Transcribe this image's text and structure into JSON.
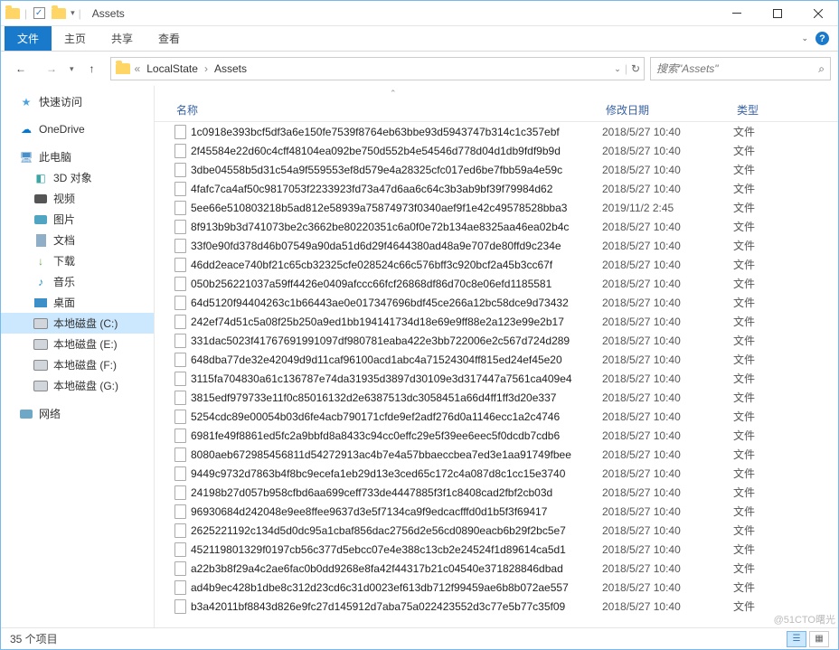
{
  "window": {
    "title": "Assets"
  },
  "tabs": {
    "file": "文件",
    "home": "主页",
    "share": "共享",
    "view": "查看"
  },
  "breadcrumbs": {
    "sep": "«",
    "items": [
      "LocalState",
      "Assets"
    ]
  },
  "search": {
    "placeholder": "搜索\"Assets\""
  },
  "nav": {
    "quick": "快速访问",
    "onedrive": "OneDrive",
    "pc": "此电脑",
    "pc_children": [
      "3D 对象",
      "视频",
      "图片",
      "文档",
      "下载",
      "音乐",
      "桌面",
      "本地磁盘 (C:)",
      "本地磁盘 (E:)",
      "本地磁盘 (F:)",
      "本地磁盘 (G:)"
    ],
    "network": "网络"
  },
  "columns": {
    "name": "名称",
    "date": "修改日期",
    "type": "类型"
  },
  "files": [
    {
      "n": "1c0918e393bcf5df3a6e150fe7539f8764eb63bbe93d5943747b314c1c357ebf",
      "d": "2018/5/27 10:40",
      "t": "文件"
    },
    {
      "n": "2f45584e22d60c4cff48104ea092be750d552b4e54546d778d04d1db9fdf9b9d",
      "d": "2018/5/27 10:40",
      "t": "文件"
    },
    {
      "n": "3dbe04558b5d31c54a9f559553ef8d579e4a28325cfc017ed6be7fbb59a4e59c",
      "d": "2018/5/27 10:40",
      "t": "文件"
    },
    {
      "n": "4fafc7ca4af50c9817053f2233923fd73a47d6aa6c64c3b3ab9bf39f79984d62",
      "d": "2018/5/27 10:40",
      "t": "文件"
    },
    {
      "n": "5ee66e510803218b5ad812e58939a75874973f0340aef9f1e42c49578528bba3",
      "d": "2019/11/2 2:45",
      "t": "文件"
    },
    {
      "n": "8f913b9b3d741073be2c3662be80220351c6a0f0e72b134ae8325aa46ea02b4c",
      "d": "2018/5/27 10:40",
      "t": "文件"
    },
    {
      "n": "33f0e90fd378d46b07549a90da51d6d29f4644380ad48a9e707de80ffd9c234e",
      "d": "2018/5/27 10:40",
      "t": "文件"
    },
    {
      "n": "46dd2eace740bf21c65cb32325cfe028524c66c576bff3c920bcf2a45b3cc67f",
      "d": "2018/5/27 10:40",
      "t": "文件"
    },
    {
      "n": "050b256221037a59ff4426e0409afccc66fcf26868df86d70c8e06efd1185581",
      "d": "2018/5/27 10:40",
      "t": "文件"
    },
    {
      "n": "64d5120f94404263c1b66443ae0e017347696bdf45ce266a12bc58dce9d73432",
      "d": "2018/5/27 10:40",
      "t": "文件"
    },
    {
      "n": "242ef74d51c5a08f25b250a9ed1bb194141734d18e69e9ff88e2a123e99e2b17",
      "d": "2018/5/27 10:40",
      "t": "文件"
    },
    {
      "n": "331dac5023f41767691991097df980781eaba422e3bb722006e2c567d724d289",
      "d": "2018/5/27 10:40",
      "t": "文件"
    },
    {
      "n": "648dba77de32e42049d9d11caf96100acd1abc4a71524304ff815ed24ef45e20",
      "d": "2018/5/27 10:40",
      "t": "文件"
    },
    {
      "n": "3115fa704830a61c136787e74da31935d3897d30109e3d317447a7561ca409e4",
      "d": "2018/5/27 10:40",
      "t": "文件"
    },
    {
      "n": "3815edf979733e11f0c85016132d2e6387513dc3058451a66d4ff1ff3d20e337",
      "d": "2018/5/27 10:40",
      "t": "文件"
    },
    {
      "n": "5254cdc89e00054b03d6fe4acb790171cfde9ef2adf276d0a1146ecc1a2c4746",
      "d": "2018/5/27 10:40",
      "t": "文件"
    },
    {
      "n": "6981fe49f8861ed5fc2a9bbfd8a8433c94cc0effc29e5f39ee6eec5f0dcdb7cdb6",
      "d": "2018/5/27 10:40",
      "t": "文件"
    },
    {
      "n": "8080aeb672985456811d54272913ac4b7e4a57bbaeccbea7ed3e1aa91749fbee",
      "d": "2018/5/27 10:40",
      "t": "文件"
    },
    {
      "n": "9449c9732d7863b4f8bc9ecefa1eb29d13e3ced65c172c4a087d8c1cc15e3740",
      "d": "2018/5/27 10:40",
      "t": "文件"
    },
    {
      "n": "24198b27d057b958cfbd6aa699ceff733de4447885f3f1c8408cad2fbf2cb03d",
      "d": "2018/5/27 10:40",
      "t": "文件"
    },
    {
      "n": "96930684d242048e9ee8ffee9637d3e5f7134ca9f9edcacfffd0d1b5f3f69417",
      "d": "2018/5/27 10:40",
      "t": "文件"
    },
    {
      "n": "2625221192c134d5d0dc95a1cbaf856dac2756d2e56cd0890eacb6b29f2bc5e7",
      "d": "2018/5/27 10:40",
      "t": "文件"
    },
    {
      "n": "452119801329f0197cb56c377d5ebcc07e4e388c13cb2e24524f1d89614ca5d1",
      "d": "2018/5/27 10:40",
      "t": "文件"
    },
    {
      "n": "a22b3b8f29a4c2ae6fac0b0dd9268e8fa42f44317b21c04540e371828846dbad",
      "d": "2018/5/27 10:40",
      "t": "文件"
    },
    {
      "n": "ad4b9ec428b1dbe8c312d23cd6c31d0023ef613db712f99459ae6b8b072ae557",
      "d": "2018/5/27 10:40",
      "t": "文件"
    },
    {
      "n": "b3a42011bf8843d826e9fc27d145912d7aba75a022423552d3c77e5b77c35f09",
      "d": "2018/5/27 10:40",
      "t": "文件"
    }
  ],
  "status": {
    "count": "35 个项目"
  },
  "watermark": "@51CTO曙光"
}
